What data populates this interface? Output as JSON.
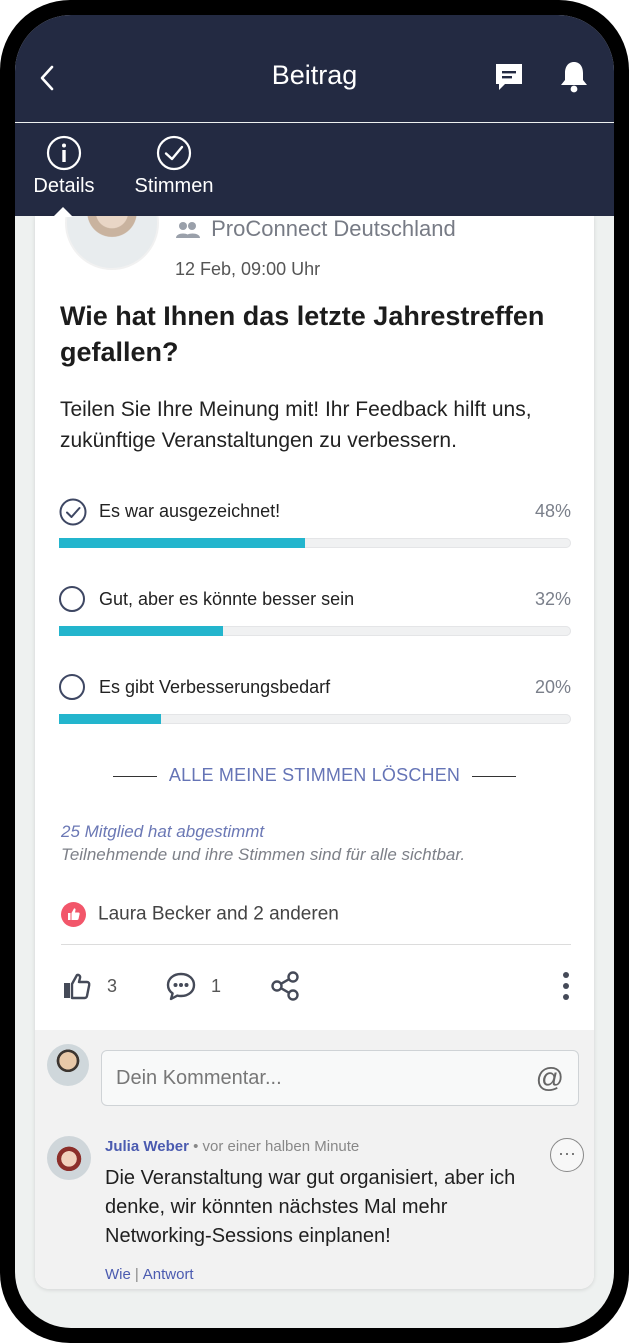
{
  "header": {
    "title": "Beitrag"
  },
  "tabs": [
    {
      "label": "Details"
    },
    {
      "label": "Stimmen"
    }
  ],
  "post": {
    "group": "ProConnect Deutschland",
    "date": "12 Feb, 09:00 Uhr",
    "title": "Wie hat Ihnen das letzte Jahrestreffen gefallen?",
    "description": "Teilen Sie Ihre Meinung mit! Ihr Feedback hilft uns, zukünftige Veranstaltungen zu verbessern."
  },
  "poll": {
    "options": [
      {
        "label": "Es war ausgezeichnet!",
        "percent_label": "48%",
        "percent": 48,
        "selected": true
      },
      {
        "label": "Gut, aber es könnte besser sein",
        "percent_label": "32%",
        "percent": 32,
        "selected": false
      },
      {
        "label": "Es gibt Verbesserungsbedarf",
        "percent_label": "20%",
        "percent": 20,
        "selected": false
      }
    ],
    "clear_label": "ALLE MEINE STIMMEN LÖSCHEN",
    "voted_text": "25 Mitglied hat abgestimmt",
    "visibility_text": "Teilnehmende und ihre Stimmen sind für alle sichtbar.",
    "bar_color": "#23b5cd"
  },
  "reactions": {
    "likes_text": "Laura Becker and 2 anderen"
  },
  "actions": {
    "like_count": "3",
    "comment_count": "1"
  },
  "comment_input": {
    "placeholder": "Dein Kommentar...",
    "at_symbol": "@"
  },
  "comment": {
    "author": "Julia Weber",
    "time": "• vor einer halben Minute",
    "text": "Die Veranstaltung war gut organisiert, aber ich denke, wir könnten nächstes Mal mehr Networking-Sessions einplanen!",
    "like_label": "Wie",
    "separator": "|",
    "reply_label": "Antwort",
    "options_glyph": "···"
  },
  "colors": {
    "header_bg": "#232a42",
    "accent": "#6574b6",
    "like_badge": "#f2566a"
  }
}
